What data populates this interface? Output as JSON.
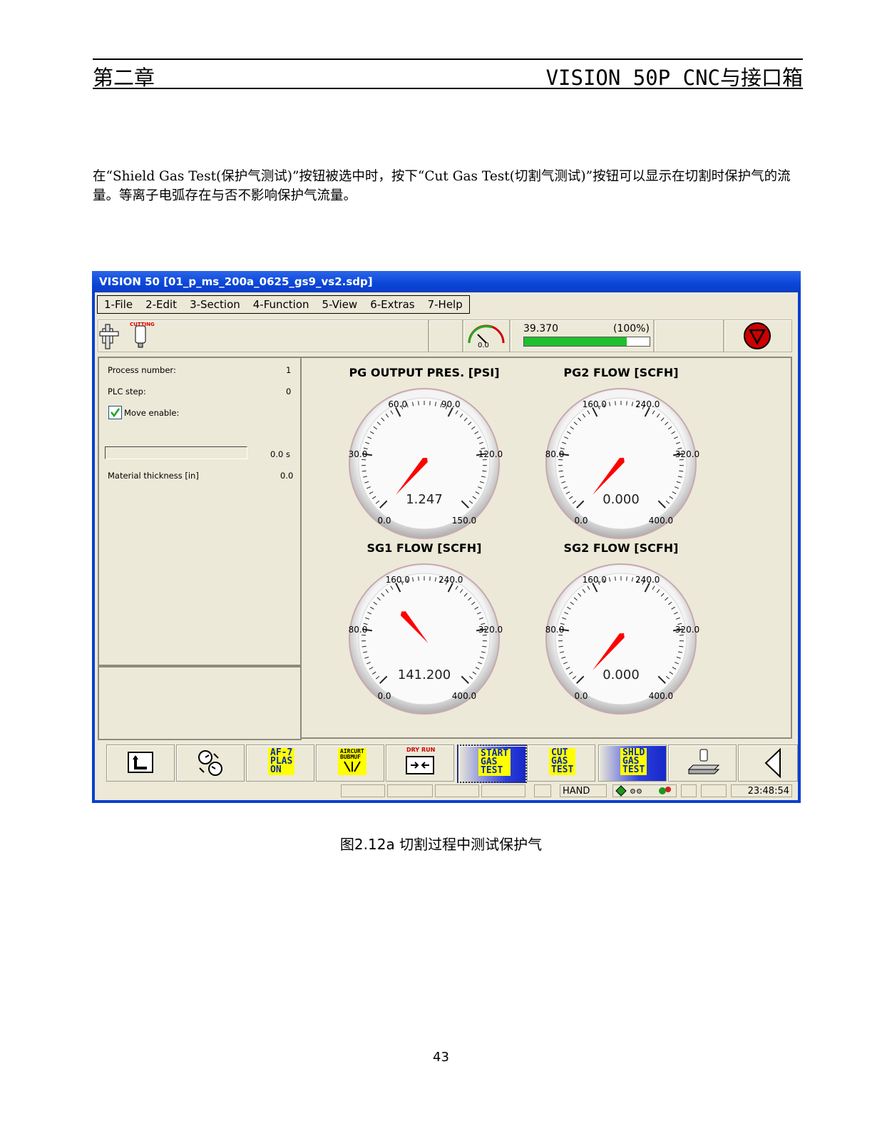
{
  "header": {
    "chapter": "第二章",
    "title": "VISION 50P CNC与接口箱"
  },
  "body": {
    "paragraph": "在“Shield Gas Test(保护气测试)”按钮被选中时，按下“Cut Gas Test(切割气测试)”按钮可以显示在切割时保护气的流量。等离子电弧存在与否不影响保护气流量。"
  },
  "window": {
    "title": "VISION 50 [01_p_ms_200a_0625_gs9_vs2.sdp]",
    "menu": [
      "1-File",
      "2-Edit",
      "3-Section",
      "4-Function",
      "5-View",
      "6-Extras",
      "7-Help"
    ],
    "toolbar": {
      "cutting_label": "CUTTING",
      "speed_gauge_value": "0.0",
      "feed_value": "39.370",
      "feed_percent": "(100%)",
      "feed_fraction": 0.82
    },
    "left_panel": {
      "process_number_label": "Process number:",
      "process_number_value": "1",
      "plc_step_label": "PLC step:",
      "plc_step_value": "0",
      "move_enable_label": "Move enable:",
      "timer_value": "0.0 s",
      "material_thickness_label": "Material thickness [in]",
      "material_thickness_value": "0.0"
    },
    "gauges": [
      {
        "title": "PG OUTPUT PRES. [PSI]",
        "value": 1.247,
        "display": "1.247",
        "min": 0,
        "max": 150,
        "ticks": [
          "0.0",
          "30.0",
          "60.0",
          "90.0",
          "120.0",
          "150.0"
        ]
      },
      {
        "title": "PG2 FLOW [SCFH]",
        "value": 0.0,
        "display": "0.000",
        "min": 0,
        "max": 400,
        "ticks": [
          "0.0",
          "80.0",
          "160.0",
          "240.0",
          "320.0",
          "400.0"
        ]
      },
      {
        "title": "SG1 FLOW [SCFH]",
        "value": 141.2,
        "display": "141.200",
        "min": 0,
        "max": 400,
        "ticks": [
          "0.0",
          "80.0",
          "160.0",
          "240.0",
          "320.0",
          "400.0"
        ]
      },
      {
        "title": "SG2 FLOW [SCFH]",
        "value": 0.0,
        "display": "0.000",
        "min": 0,
        "max": 400,
        "ticks": [
          "0.0",
          "80.0",
          "160.0",
          "240.0",
          "320.0",
          "400.0"
        ]
      }
    ],
    "function_keys": {
      "af_plas_on": [
        "AF-7",
        "PLAS",
        "ON"
      ],
      "aircurt": [
        "AIRCURT",
        "BUBMUF"
      ],
      "dry_run": "DRY RUN",
      "start_gas_test": [
        "START",
        "GAS",
        "TEST"
      ],
      "cut_gas_test": [
        "CUT",
        "GAS",
        "TEST"
      ],
      "shld_gas_test": [
        "SHLD",
        "GAS",
        "TEST"
      ]
    },
    "status": {
      "mode": "HAND",
      "time": "23:48:54"
    },
    "colors": {
      "titlebar": "#0a46d8",
      "needle": "#ff0000",
      "progress": "#1fbf2f",
      "button_yellow": "#ffff00"
    }
  },
  "caption": "图2.12a  切割过程中测试保护气",
  "page_number": "43"
}
